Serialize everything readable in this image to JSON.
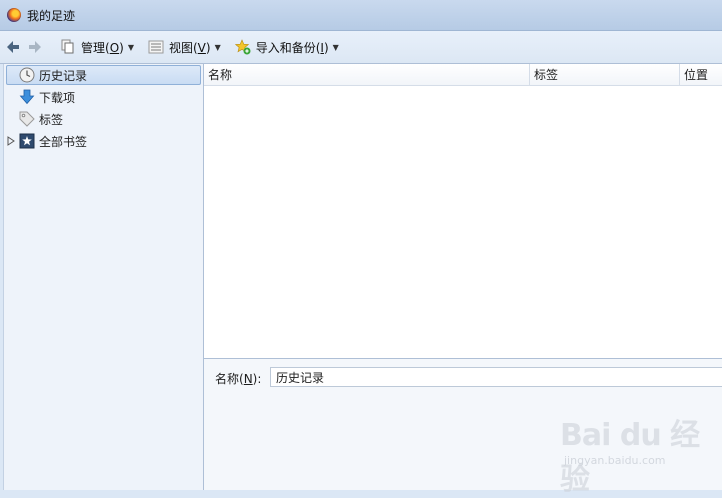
{
  "window": {
    "title": "我的足迹"
  },
  "toolbar": {
    "manage": {
      "text": "管理(",
      "key": "O",
      "tail": ")"
    },
    "views": {
      "text": "视图(",
      "key": "V",
      "tail": ")"
    },
    "import": {
      "text": "导入和备份(",
      "key": "I",
      "tail": ")"
    }
  },
  "sidebar": {
    "items": [
      {
        "label": "历史记录",
        "icon": "clock-icon",
        "selected": true
      },
      {
        "label": "下载项",
        "icon": "download-arrow-icon"
      },
      {
        "label": "标签",
        "icon": "tag-icon"
      },
      {
        "label": "全部书签",
        "icon": "bookmarks-star-icon",
        "expandable": true
      }
    ]
  },
  "table": {
    "columns": [
      "名称",
      "标签",
      "位置"
    ]
  },
  "details": {
    "name_label_text": "名称(",
    "name_label_key": "N",
    "name_label_tail": "):",
    "name_value": "历史记录"
  },
  "watermark": {
    "main": "Bai du 经验",
    "sub": "jingyan.baidu.com"
  },
  "colors": {
    "accent": "#2b7cd3",
    "selection_border": "#8fb0d8",
    "background": "#dbe7f5"
  }
}
